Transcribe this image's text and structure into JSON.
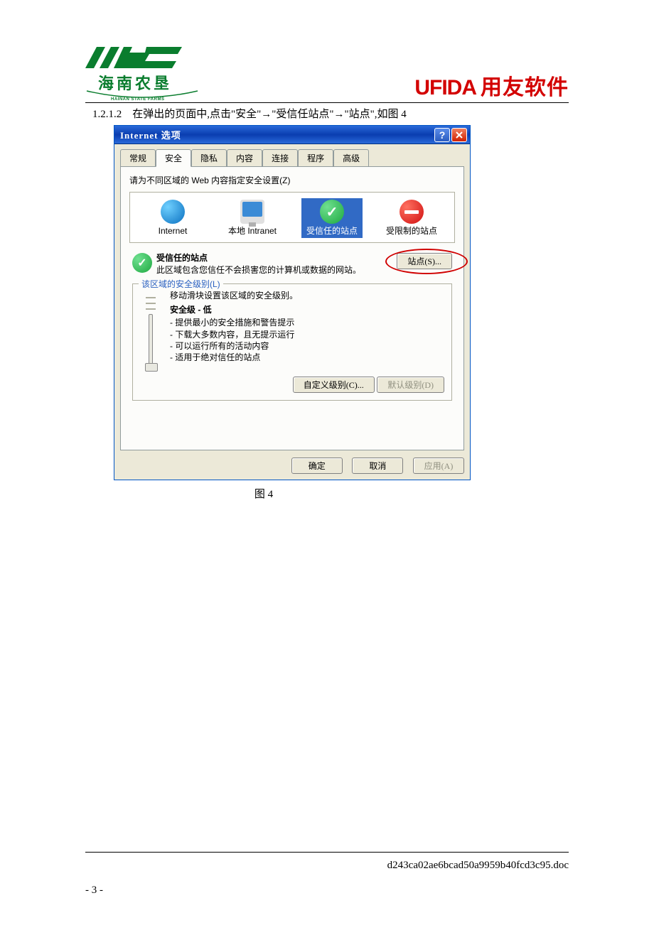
{
  "header": {
    "hsf_cn": "海南农垦",
    "hsf_en": "HAINAN STATE FARMS",
    "ufida_en": "UFIDA",
    "ufida_cn": "用友软件"
  },
  "instruction": {
    "section_no": "1.2.1.2",
    "prefix": "在弹出的页面中,点击",
    "step1": "\"安全\"",
    "step2": "\"受信任站点\"",
    "step3": "\"站点\"",
    "suffix": ",如图 4",
    "arrow": "→"
  },
  "dialog": {
    "title": "Internet 选项",
    "tabs": [
      "常规",
      "安全",
      "隐私",
      "内容",
      "连接",
      "程序",
      "高级"
    ],
    "active_tab": 1,
    "panel_instruction": "请为不同区域的 Web 内容指定安全设置(Z)",
    "zones": [
      {
        "label": "Internet"
      },
      {
        "label": "本地 Intranet"
      },
      {
        "label": "受信任的站点"
      },
      {
        "label": "受限制的站点"
      }
    ],
    "selected_zone": 2,
    "trusted": {
      "title": "受信任的站点",
      "desc": "此区域包含您信任不会损害您的计算机或数据的网站。",
      "sites_btn": "站点(S)..."
    },
    "security_level": {
      "legend": "该区域的安全级别(L)",
      "hint": "移动滑块设置该区域的安全级别。",
      "level_title": "安全级 - 低",
      "bullets": [
        "提供最小的安全措施和警告提示",
        "下载大多数内容，且无提示运行",
        "可以运行所有的活动内容",
        "适用于绝对信任的站点"
      ],
      "custom_btn": "自定义级别(C)...",
      "default_btn": "默认级别(D)"
    },
    "footer": {
      "ok": "确定",
      "cancel": "取消",
      "apply": "应用(A)"
    }
  },
  "figure_caption": "图 4",
  "doc_footer": {
    "filename": "d243ca02ae6bcad50a9959b40fcd3c95.doc",
    "page": "- 3 -"
  }
}
